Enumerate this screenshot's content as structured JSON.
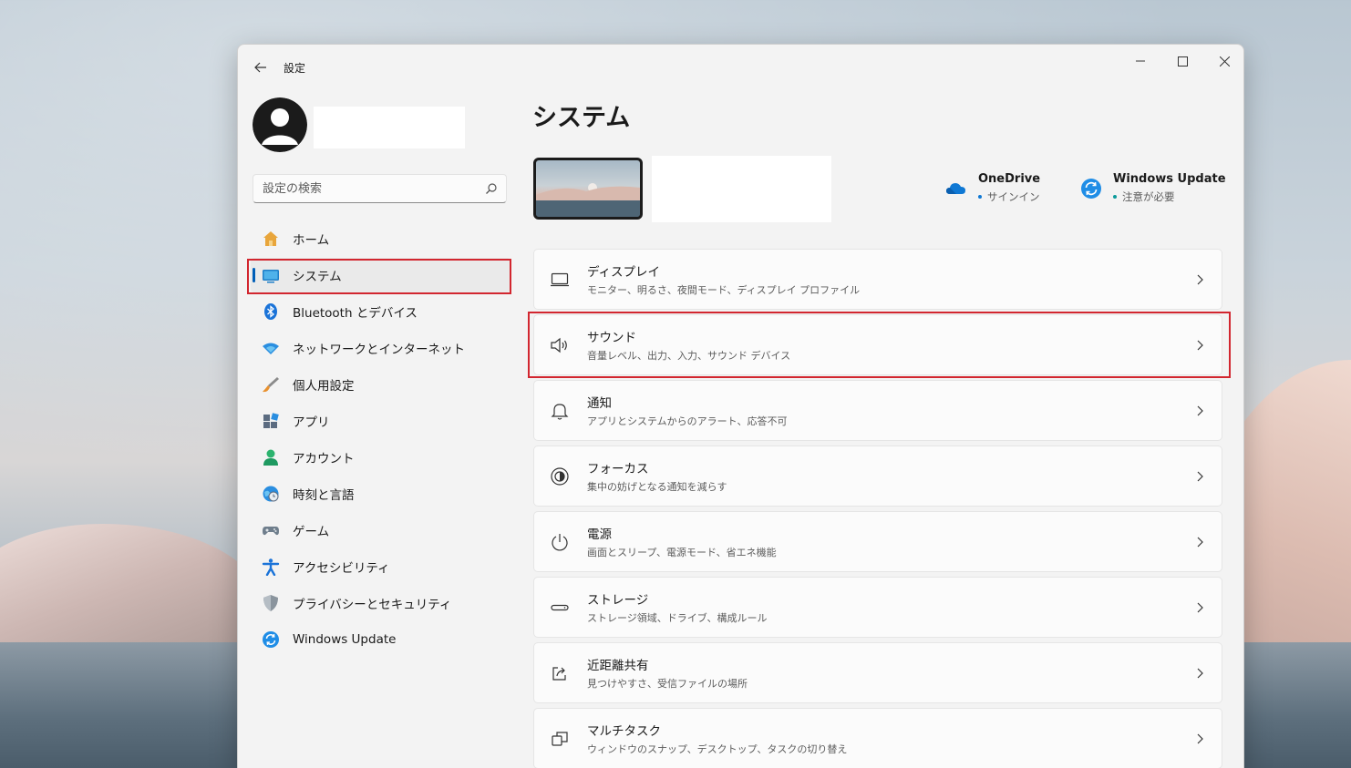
{
  "window": {
    "app_title": "設定"
  },
  "sidebar": {
    "search_placeholder": "設定の検索",
    "items": [
      {
        "label": "ホーム",
        "icon": "home-icon"
      },
      {
        "label": "システム",
        "icon": "system-icon",
        "active": true
      },
      {
        "label": "Bluetooth とデバイス",
        "icon": "bluetooth-icon"
      },
      {
        "label": "ネットワークとインターネット",
        "icon": "wifi-icon"
      },
      {
        "label": "個人用設定",
        "icon": "brush-icon"
      },
      {
        "label": "アプリ",
        "icon": "apps-icon"
      },
      {
        "label": "アカウント",
        "icon": "account-icon"
      },
      {
        "label": "時刻と言語",
        "icon": "globe-clock-icon"
      },
      {
        "label": "ゲーム",
        "icon": "gamepad-icon"
      },
      {
        "label": "アクセシビリティ",
        "icon": "accessibility-icon"
      },
      {
        "label": "プライバシーとセキュリティ",
        "icon": "shield-icon"
      },
      {
        "label": "Windows Update",
        "icon": "windows-update-icon"
      }
    ]
  },
  "main": {
    "page_title": "システム",
    "status": {
      "onedrive": {
        "title": "OneDrive",
        "sub": "サインイン"
      },
      "windows_update": {
        "title": "Windows Update",
        "sub": "注意が必要"
      }
    },
    "cards": [
      {
        "title": "ディスプレイ",
        "sub": "モニター、明るさ、夜間モード、ディスプレイ プロファイル",
        "icon": "display-icon"
      },
      {
        "title": "サウンド",
        "sub": "音量レベル、出力、入力、サウンド デバイス",
        "icon": "speaker-icon"
      },
      {
        "title": "通知",
        "sub": "アプリとシステムからのアラート、応答不可",
        "icon": "bell-icon"
      },
      {
        "title": "フォーカス",
        "sub": "集中の妨げとなる通知を減らす",
        "icon": "focus-icon"
      },
      {
        "title": "電源",
        "sub": "画面とスリープ、電源モード、省エネ機能",
        "icon": "power-icon"
      },
      {
        "title": "ストレージ",
        "sub": "ストレージ領域、ドライブ、構成ルール",
        "icon": "storage-icon"
      },
      {
        "title": "近距離共有",
        "sub": "見つけやすさ、受信ファイルの場所",
        "icon": "share-icon"
      },
      {
        "title": "マルチタスク",
        "sub": "ウィンドウのスナップ、デスクトップ、タスクの切り替え",
        "icon": "multitask-icon"
      }
    ]
  },
  "colors": {
    "accent": "#005fb8",
    "highlight_box": "#d2262f",
    "onedrive_blue": "#0f78d4",
    "update_blue": "#1f8de6",
    "update_dot": "#0b9a9a"
  }
}
